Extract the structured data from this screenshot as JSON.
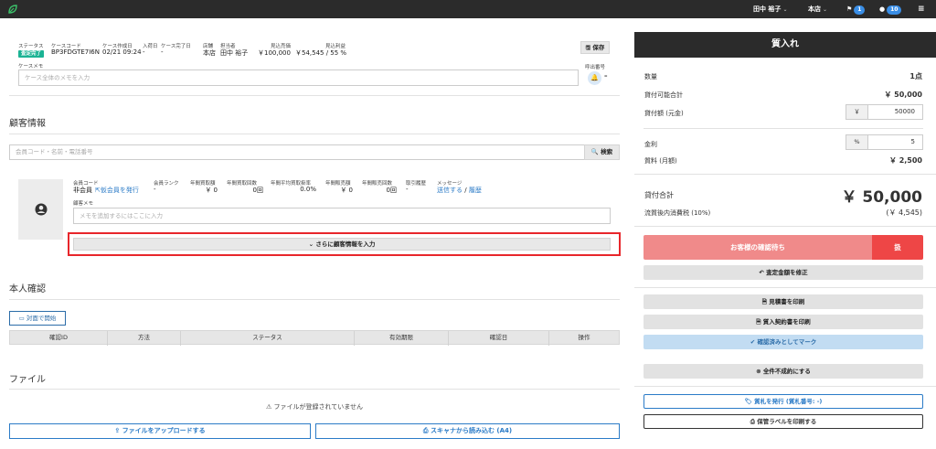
{
  "topbar": {
    "logo_icon": "leaf-logo-icon",
    "user": "田中 裕子",
    "store": "本店",
    "flag_count": "1",
    "message_count": "10"
  },
  "case": {
    "labels": {
      "status": "ステータス",
      "case_code": "ケースコード",
      "created": "ケース作成日",
      "stock_date": "入荷日",
      "completed": "ケース完了日",
      "store": "店舗",
      "staff": "担当者",
      "est_sales": "見込売価",
      "est_profit": "見込利益"
    },
    "status_tag": "査定完了",
    "case_code": "BP3FDGTE7I6N",
    "created": "02/21 09:24",
    "stock_date": "-",
    "completed": "-",
    "store": "本店",
    "staff": "田中 裕子",
    "est_sales": "￥100,000",
    "est_profit": "￥54,545 / 55 %",
    "save_label": "保存",
    "memo_label": "ケースメモ",
    "memo_placeholder": "ケース全体のメモを入力",
    "call_number_label": "呼出番号",
    "call_number_value": "–"
  },
  "customer": {
    "title": "顧客情報",
    "search_placeholder": "会員コード・名前・電話番号",
    "search_button": "検索",
    "labels": {
      "member_code": "会員コード",
      "rank": "会員ランク",
      "annual_buy": "年間買取額",
      "annual_buy_count": "年間買取回数",
      "annual_avg_rate": "年間平均買取掛率",
      "annual_sales": "年間販売額",
      "annual_sales_count": "年間販売回数",
      "history": "取引履歴",
      "message": "メッセージ"
    },
    "member_code_value": "非会員",
    "provisional_link": "仮会員を発行",
    "rank_value": "-",
    "annual_buy_value": "￥ 0",
    "annual_buy_count_value": "0回",
    "annual_avg_rate_value": "0.0%",
    "annual_sales_value": "￥ 0",
    "annual_sales_count_value": "0回",
    "history_value": "-",
    "send_link": "送信する",
    "sep": "/",
    "history_link": "履歴",
    "memo_label": "顧客メモ",
    "memo_placeholder": "メモを追加するにはここに入力",
    "more_button": "さらに顧客情報を入力"
  },
  "identity": {
    "title": "本人確認",
    "start_button": "対面で開始",
    "columns": [
      "確認ID",
      "方法",
      "ステータス",
      "有効期限",
      "確認日",
      "操作"
    ]
  },
  "files": {
    "title": "ファイル",
    "empty": "ファイルが登録されていません",
    "upload_button": "ファイルをアップロードする",
    "scan_button": "スキャナから読み込む (A4)"
  },
  "panel": {
    "title": "質入れ",
    "quantity_label": "数量",
    "quantity_value": "1点",
    "loanable_label": "貸付可能合計",
    "loanable_value": "￥ 50,000",
    "loan_amount_label": "貸付額 (元金)",
    "loan_currency": "￥",
    "loan_amount_value": "50000",
    "rate_label": "金利",
    "rate_unit": "%",
    "rate_value": "5",
    "fee_label": "質料 (月額)",
    "fee_value": "￥ 2,500",
    "total_label": "貸付合計",
    "total_value": "￥ 50,000",
    "tax_label": "流質後内消費税 (10%)",
    "tax_value": "(￥ 4,545)",
    "waiting_button": "お客様の確認待ち",
    "side_button": "扱",
    "fix_price": "査定金額を修正",
    "print_estimate": "見積書を印刷",
    "print_contract": "質入契約書を印刷",
    "mark_confirmed": "確認済みとしてマーク",
    "all_fail": "全件不成約にする",
    "issue_ticket": "質札を発行 (質札番号: -)",
    "print_label": "保管ラベルを印刷する",
    "colors": {
      "danger": "#f08a8a",
      "danger_dark": "#ee4646",
      "info": "#c2dcf2"
    }
  }
}
